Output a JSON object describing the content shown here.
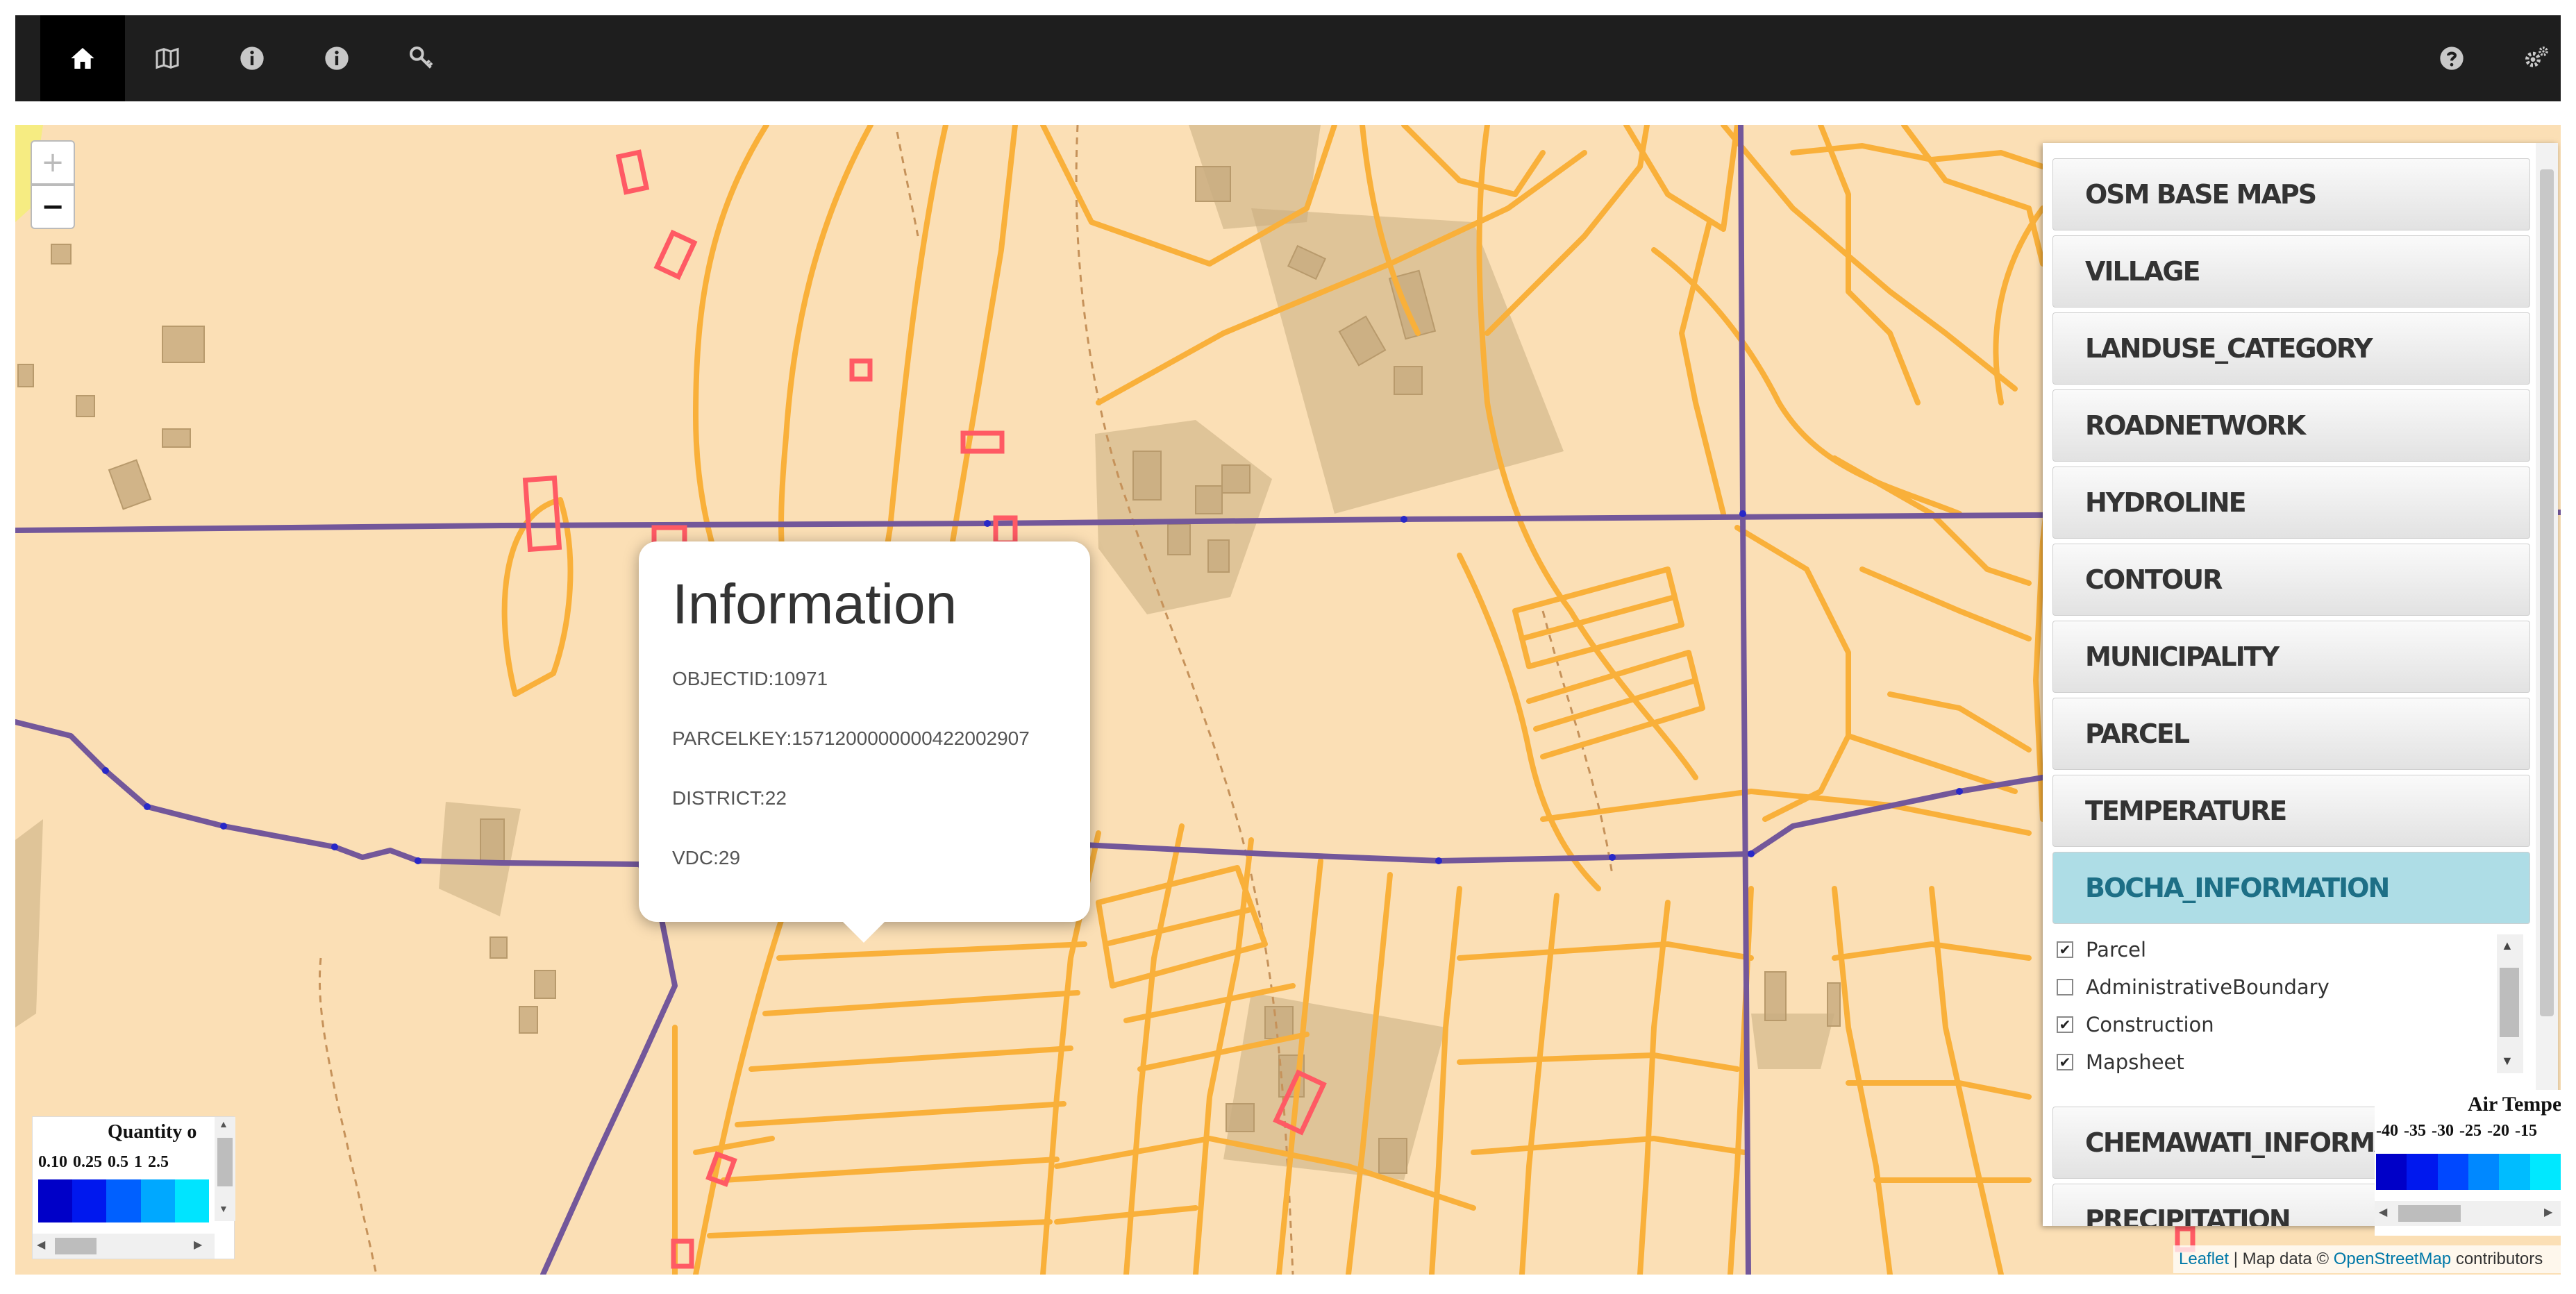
{
  "navbar": {
    "left_icons": [
      "home-icon",
      "map-icon",
      "info-icon",
      "info-icon",
      "key-icon"
    ],
    "right_icons": [
      "help-icon",
      "settings-icon"
    ]
  },
  "map": {
    "zoom_in_label": "+",
    "zoom_out_label": "−"
  },
  "popup": {
    "title": "Information",
    "objectid": "OBJECTID:10971",
    "parcelkey": "PARCELKEY:1571200000000422002907",
    "district": "DISTRICT:22",
    "vdc": "VDC:29"
  },
  "layer_panel": {
    "groups": [
      "OSM BASE MAPS",
      "VILLAGE",
      "LANDUSE_CATEGORY",
      "ROADNETWORK",
      "HYDROLINE",
      "CONTOUR",
      "MUNICIPALITY",
      "PARCEL",
      "TEMPERATURE",
      "BOCHA_INFORMATION",
      "CHEMAWATI_INFORMATION",
      "PRECIPITATION"
    ],
    "active_group": "BOCHA_INFORMATION",
    "sublayers": [
      {
        "label": "Parcel",
        "checked": true
      },
      {
        "label": "AdministrativeBoundary",
        "checked": false
      },
      {
        "label": "Construction",
        "checked": true
      },
      {
        "label": "Mapsheet",
        "checked": true
      }
    ]
  },
  "legend_quantity": {
    "title": "Quantity o",
    "ticks": [
      "0.10",
      "0.25",
      "0.5",
      "1",
      "2.5"
    ],
    "colors": [
      "#0000c8",
      "#0018ee",
      "#0060ff",
      "#00a8ff",
      "#00e4ff"
    ]
  },
  "legend_temperature": {
    "title": "Air Tempe",
    "ticks": [
      "-40",
      "-35",
      "-30",
      "-25",
      "-20",
      "-15"
    ],
    "colors": [
      "#0000c8",
      "#0018ee",
      "#0048ff",
      "#0088ff",
      "#00bcff",
      "#00e8ff"
    ]
  },
  "attribution": {
    "leaflet": "Leaflet",
    "sep": " | Map data © ",
    "osm": "OpenStreetMap",
    "tail": " contributors"
  },
  "colors": {
    "background": "#fbdfb5",
    "parcel_line": "#f9b03a",
    "admin_boundary": "#73579a",
    "construction": "#ff5a64",
    "landuse_patch": "#c9ad80"
  }
}
